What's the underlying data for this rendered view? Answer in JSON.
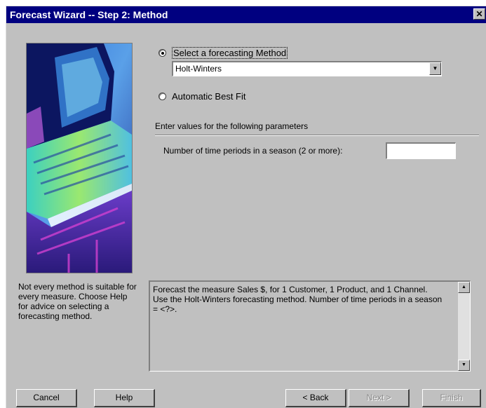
{
  "window": {
    "title": "Forecast Wizard -- Step 2: Method",
    "close_glyph": "✕"
  },
  "method": {
    "select_label": "Select a forecasting Method",
    "selected_value": "Holt-Winters",
    "auto_label": "Automatic Best Fit"
  },
  "params": {
    "section_label": "Enter values for the following parameters",
    "season_label": "Number of time periods in a season (2 or more):",
    "season_value": ""
  },
  "note": "Not every method is suitable for every measure. Choose Help for advice on selecting a forecasting method.",
  "description": "Forecast the measure Sales $, for 1 Customer, 1 Product, and 1 Channel.\nUse the Holt-Winters forecasting method. Number of time periods in a season = <?>.",
  "buttons": {
    "cancel": "Cancel",
    "help": "Help",
    "back": "< Back",
    "next": "Next >",
    "finish": "Finish"
  }
}
